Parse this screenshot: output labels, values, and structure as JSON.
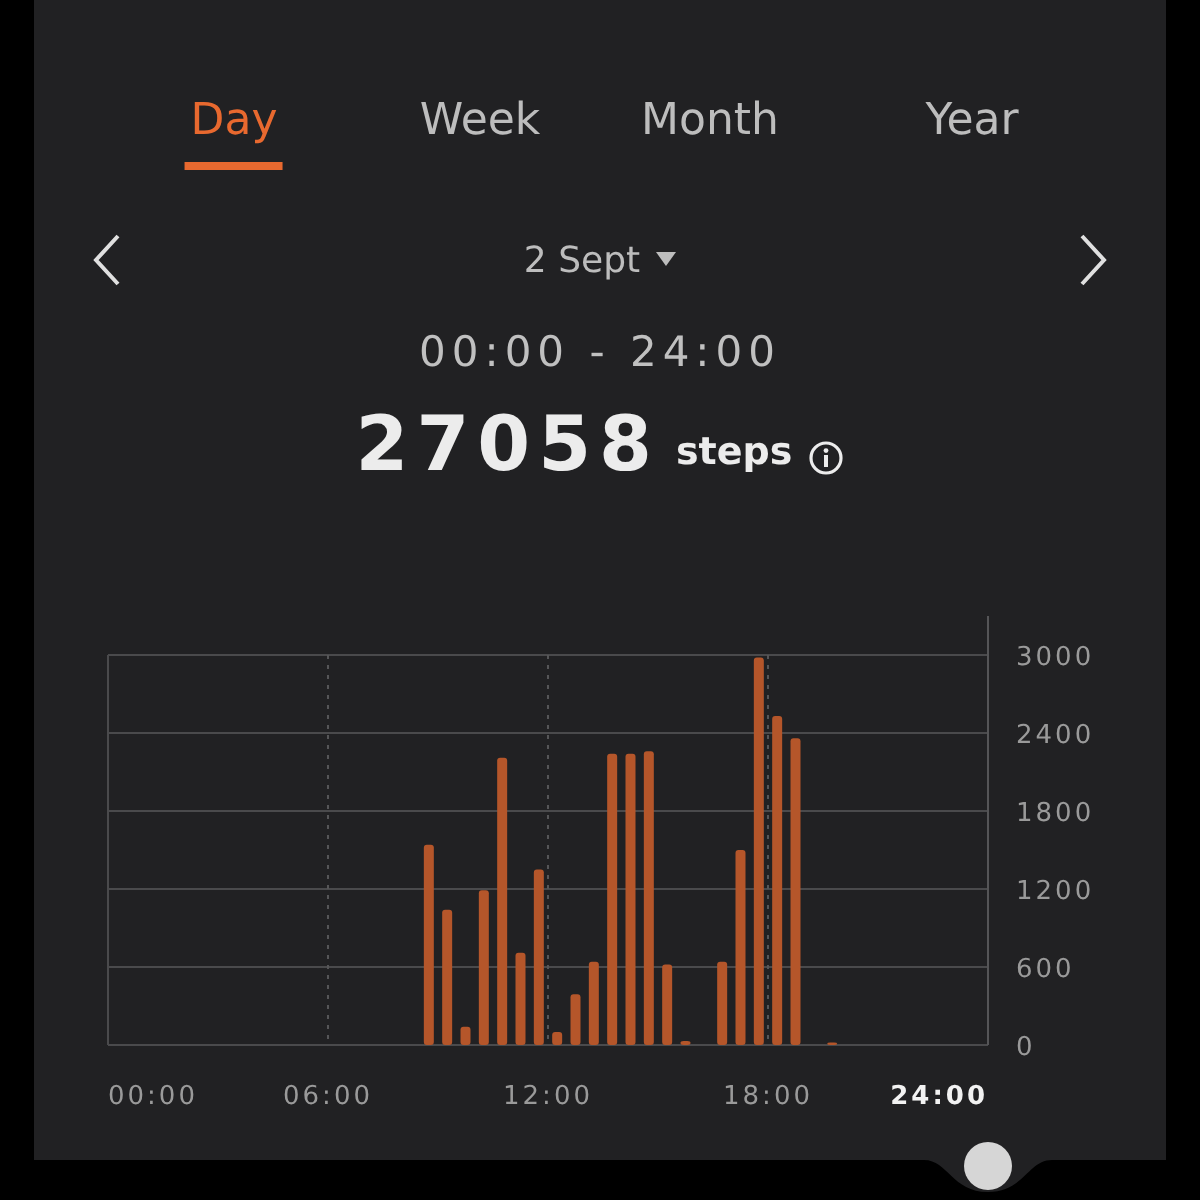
{
  "tabs": [
    {
      "label": "Day",
      "selected": true
    },
    {
      "label": "Week",
      "selected": false
    },
    {
      "label": "Month",
      "selected": false
    },
    {
      "label": "Year",
      "selected": false
    }
  ],
  "date": {
    "label": "2 Sept"
  },
  "range": "00:00 - 24:00",
  "total": {
    "value": "27058",
    "unit": "steps"
  },
  "chart": {
    "chart_data": {
      "type": "bar",
      "grid": true,
      "x": [
        0.25,
        0.75,
        1.25,
        1.75,
        2.25,
        2.75,
        3.25,
        3.75,
        4.25,
        4.75,
        5.25,
        5.75,
        6.25,
        6.75,
        7.25,
        7.75,
        8.25,
        8.75,
        9.25,
        9.75,
        10.25,
        10.75,
        11.25,
        11.75,
        12.25,
        12.75,
        13.25,
        13.75,
        14.25,
        14.75,
        15.25,
        15.75,
        16.25,
        16.75,
        17.25,
        17.75,
        18.25,
        18.75,
        19.25,
        19.75,
        20.25,
        20.75,
        21.25,
        21.75,
        22.25,
        22.75,
        23.25,
        23.75
      ],
      "xlim": [
        0,
        24
      ],
      "series": [
        {
          "color": "#b5562a",
          "values": [
            0,
            0,
            0,
            0,
            0,
            0,
            0,
            0,
            0,
            0,
            0,
            0,
            0,
            0,
            0,
            0,
            0,
            1540,
            1040,
            140,
            1190,
            2210,
            710,
            1350,
            100,
            390,
            640,
            2240,
            2240,
            2260,
            620,
            30,
            0,
            640,
            1500,
            2980,
            2530,
            2360,
            0,
            20,
            0,
            0,
            0,
            0,
            0,
            0,
            0,
            0
          ]
        }
      ],
      "ylim": [
        0,
        3000
      ],
      "yticks": [
        0,
        600,
        1200,
        1800,
        2400,
        3000
      ],
      "xticks": [
        {
          "value": 0,
          "label": "00:00"
        },
        {
          "value": 6,
          "label": "06:00"
        },
        {
          "value": 12,
          "label": "12:00"
        },
        {
          "value": 18,
          "label": "18:00"
        },
        {
          "value": 24,
          "label": "24:00"
        }
      ]
    }
  }
}
